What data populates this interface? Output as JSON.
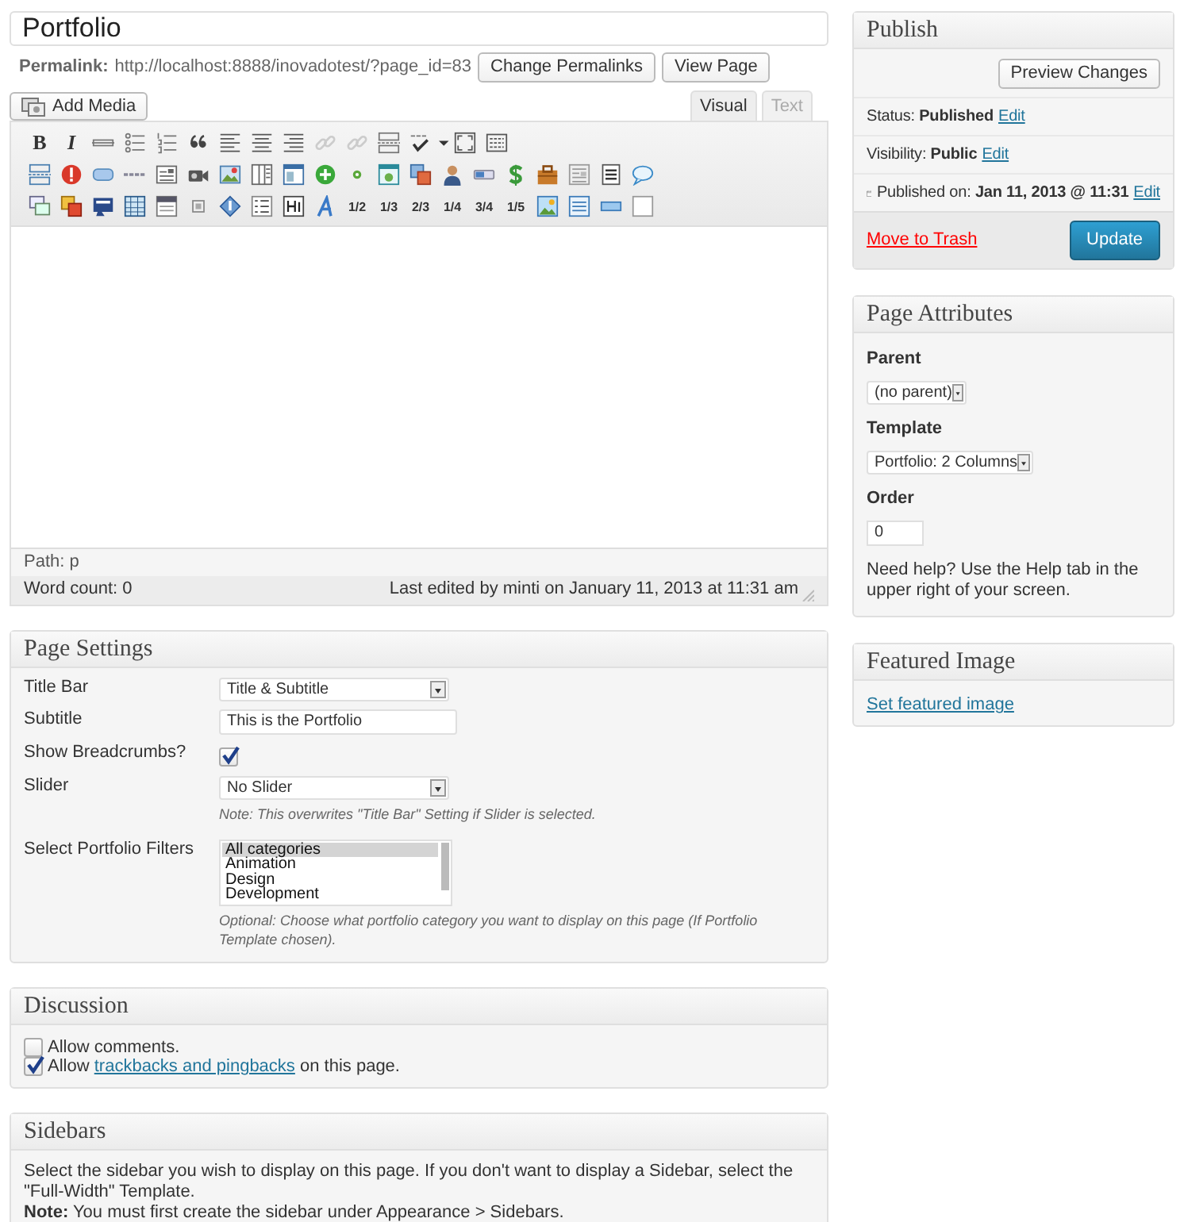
{
  "title_field": {
    "value": "Portfolio"
  },
  "permalink": {
    "label": "Permalink:",
    "url": "http://localhost:8888/inovadotest/?page_id=83",
    "buttons": [
      "Change Permalinks",
      "View Page"
    ]
  },
  "add_media_button": "Add Media",
  "editor_tabs": [
    {
      "label": "Visual",
      "selected": true
    },
    {
      "label": "Text",
      "selected": false
    }
  ],
  "toolbar_rows": [
    [
      {
        "kind": "glyph",
        "text": "B"
      },
      {
        "kind": "glyph",
        "text": "I"
      },
      {
        "kind": "icon"
      },
      {
        "kind": "icon"
      },
      {
        "kind": "icon"
      },
      {
        "kind": "icon"
      },
      {
        "kind": "icon"
      },
      {
        "kind": "icon"
      },
      {
        "kind": "icon"
      },
      {
        "kind": "icon"
      },
      {
        "kind": "icon"
      },
      {
        "kind": "icon"
      },
      {
        "kind": "icon"
      },
      {
        "kind": "icon"
      },
      {
        "kind": "icon"
      },
      {
        "kind": "icon"
      }
    ],
    [
      {
        "kind": "icon"
      },
      {
        "kind": "icon"
      },
      {
        "kind": "icon"
      },
      {
        "kind": "icon"
      },
      {
        "kind": "icon"
      },
      {
        "kind": "icon"
      },
      {
        "kind": "icon"
      },
      {
        "kind": "icon"
      },
      {
        "kind": "icon"
      },
      {
        "kind": "icon"
      },
      {
        "kind": "icon"
      },
      {
        "kind": "icon"
      },
      {
        "kind": "icon"
      },
      {
        "kind": "icon"
      },
      {
        "kind": "icon"
      },
      {
        "kind": "icon"
      },
      {
        "kind": "icon"
      },
      {
        "kind": "icon"
      },
      {
        "kind": "icon"
      },
      {
        "kind": "icon"
      }
    ],
    [
      {
        "kind": "icon"
      },
      {
        "kind": "icon"
      },
      {
        "kind": "icon"
      },
      {
        "kind": "icon"
      },
      {
        "kind": "icon"
      },
      {
        "kind": "icon"
      },
      {
        "kind": "icon"
      },
      {
        "kind": "icon"
      },
      {
        "kind": "icon"
      },
      {
        "kind": "icon"
      },
      {
        "kind": "fraction",
        "text": "1/2"
      },
      {
        "kind": "fraction",
        "text": "1/3"
      },
      {
        "kind": "fraction",
        "text": "2/3"
      },
      {
        "kind": "fraction",
        "text": "1/4"
      },
      {
        "kind": "fraction",
        "text": "3/4"
      },
      {
        "kind": "fraction",
        "text": "1/5"
      },
      {
        "kind": "icon"
      },
      {
        "kind": "icon"
      },
      {
        "kind": "icon"
      },
      {
        "kind": "icon"
      }
    ]
  ],
  "editor": {
    "path": "Path: p",
    "word_count": "Word count: 0",
    "last_edited": "Last edited by minti on January 11, 2013 at 11:31 am"
  },
  "page_settings": {
    "title": "Page Settings",
    "fields": [
      {
        "kind": "select",
        "label": "Title Bar",
        "value": "Title & Subtitle"
      },
      {
        "kind": "text",
        "label": "Subtitle",
        "value": "This is the Portfolio"
      },
      {
        "kind": "checkbox",
        "label": "Show Breadcrumbs?",
        "checked": true
      },
      {
        "kind": "select",
        "label": "Slider",
        "value": "No Slider",
        "note": "Note: This overwrites \"Title Bar\" Setting if Slider is selected."
      },
      {
        "kind": "listbox",
        "label": "Select Portfolio Filters",
        "options": [
          {
            "text": "All categories",
            "selected": true
          },
          {
            "text": "Animation",
            "selected": false
          },
          {
            "text": "Design",
            "selected": false
          },
          {
            "text": "Development",
            "selected": false
          }
        ],
        "note": "Optional: Choose what portfolio category you want to display on this page (If Portfolio Template chosen)."
      }
    ]
  },
  "discussion": {
    "title": "Discussion",
    "options": [
      {
        "checked": false,
        "text": "Allow comments."
      },
      {
        "checked": true,
        "text": "Allow",
        "link": "trackbacks and pingbacks",
        "after": "on this page."
      }
    ]
  },
  "sidebars": {
    "title": "Sidebars",
    "text": "Select the sidebar you wish to display on this page. If you don't want to display a Sidebar, select the \"Full-Width\" Template.",
    "note": "**Note:** You must first create the sidebar under Appearance > Sidebars."
  },
  "publish": {
    "title": "Publish",
    "preview_button": "Preview Changes",
    "rows": [
      {
        "kind": "plain",
        "label": "Status:",
        "value": "Published",
        "action": "Edit"
      },
      {
        "kind": "plain",
        "label": "Visibility:",
        "value": "Public",
        "action": "Edit"
      },
      {
        "kind": "date",
        "label": "Published on:",
        "value": "Jan 11, 2013 @ 11:31",
        "action": "Edit"
      }
    ],
    "trash_link": "Move to Trash",
    "update_button": "Update"
  },
  "page_attributes": {
    "title": "Page Attributes",
    "parent_label": "Parent",
    "parent_value": "(no parent)",
    "template_label": "Template",
    "template_value": "Portfolio: 2 Columns",
    "order_label": "Order",
    "order_value": "0",
    "help": "Need help? Use the Help tab in the upper right of your screen."
  },
  "featured_image": {
    "title": "Featured Image",
    "link": "Set featured image"
  }
}
